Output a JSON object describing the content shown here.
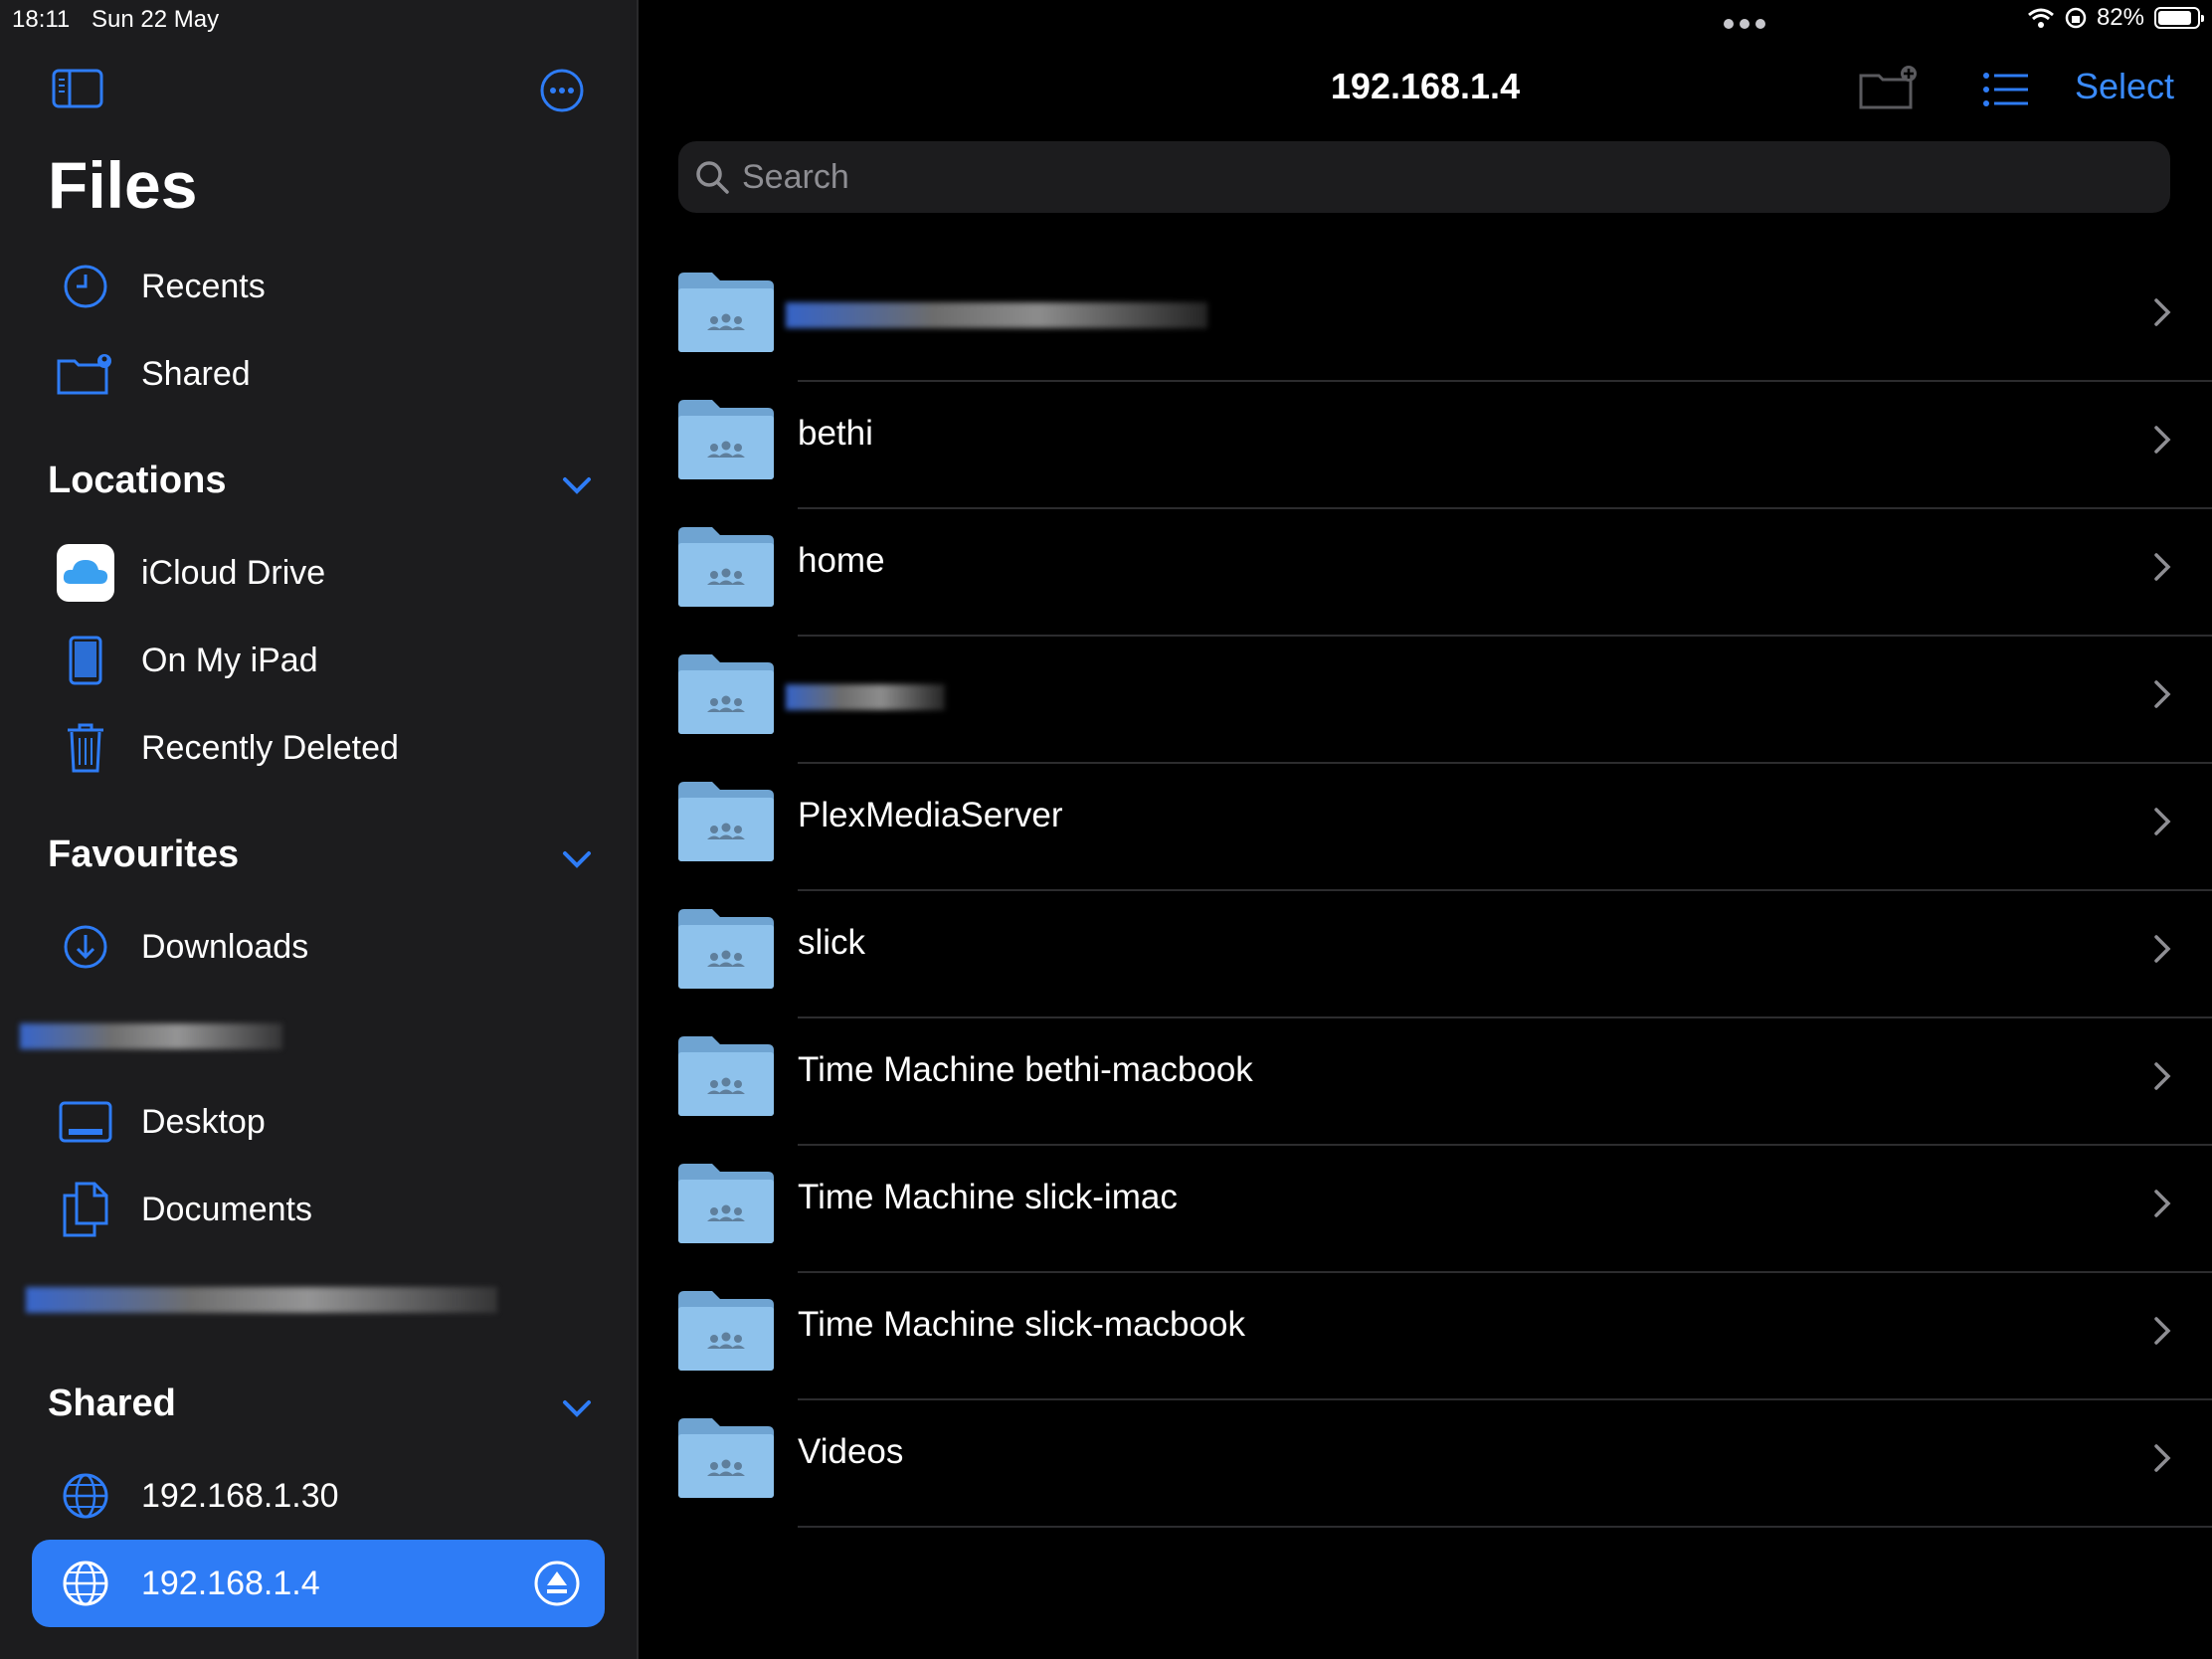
{
  "status_bar": {
    "time": "18:11",
    "date": "Sun 22 May",
    "battery": "82%",
    "battery_level": 0.82
  },
  "sidebar": {
    "title": "Files",
    "top_items": [
      {
        "label": "Recents",
        "icon": "clock-icon"
      },
      {
        "label": "Shared",
        "icon": "shared-folder-icon"
      }
    ],
    "locations": {
      "header": "Locations",
      "items": [
        {
          "label": "iCloud Drive",
          "icon": "icloud-icon"
        },
        {
          "label": "On My iPad",
          "icon": "ipad-icon"
        },
        {
          "label": "Recently Deleted",
          "icon": "trash-icon"
        }
      ]
    },
    "favourites": {
      "header": "Favourites",
      "items": [
        {
          "label": "Downloads",
          "icon": "download-icon"
        },
        {
          "label": "",
          "icon": "redacted"
        },
        {
          "label": "Desktop",
          "icon": "desktop-icon"
        },
        {
          "label": "Documents",
          "icon": "documents-icon"
        },
        {
          "label": "",
          "icon": "redacted"
        }
      ]
    },
    "shared": {
      "header": "Shared",
      "items": [
        {
          "label": "192.168.1.30",
          "icon": "globe-icon"
        },
        {
          "label": "192.168.1.4",
          "icon": "globe-icon",
          "selected": true
        }
      ]
    }
  },
  "main": {
    "title": "192.168.1.4",
    "select_label": "Select",
    "search_placeholder": "Search",
    "folders": [
      {
        "name": "",
        "redacted": true
      },
      {
        "name": "bethi"
      },
      {
        "name": "home"
      },
      {
        "name": "",
        "redacted": true
      },
      {
        "name": "PlexMediaServer"
      },
      {
        "name": "slick"
      },
      {
        "name": "Time Machine bethi-macbook"
      },
      {
        "name": "Time Machine slick-imac"
      },
      {
        "name": "Time Machine slick-macbook"
      },
      {
        "name": "Videos"
      }
    ]
  },
  "colors": {
    "accent": "#2e7cf6",
    "link": "#3a8bff",
    "sidebar_bg": "#1c1c1e",
    "folder": "#82b8e6"
  }
}
